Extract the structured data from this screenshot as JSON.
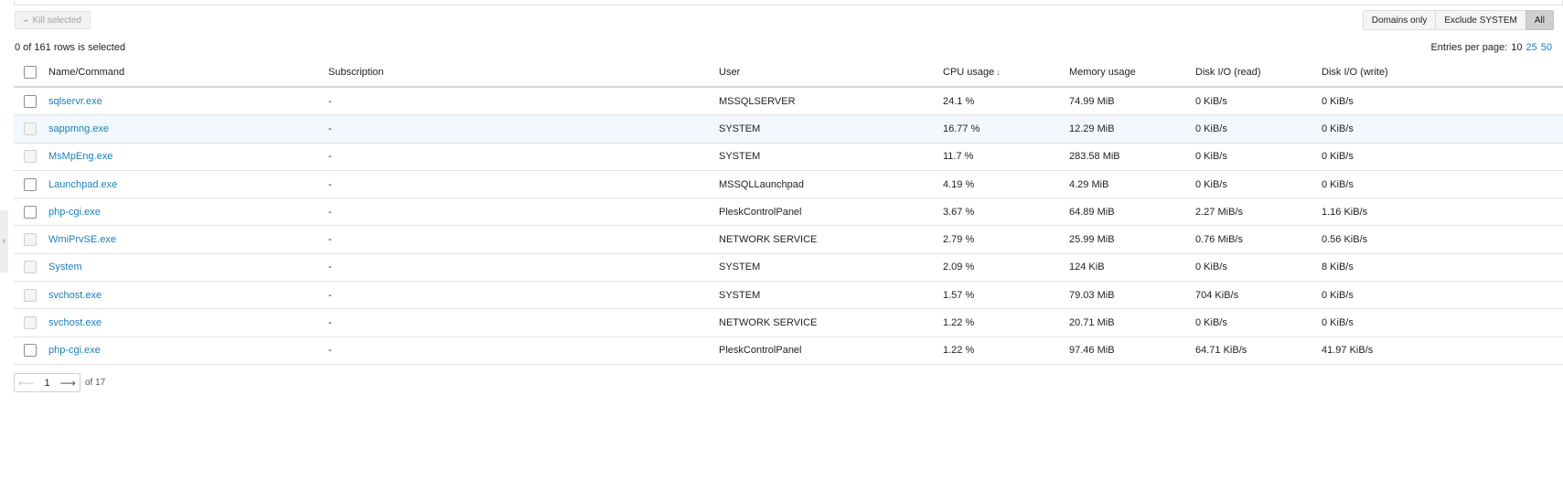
{
  "toolbar": {
    "kill_label": "Kill selected",
    "filters": [
      {
        "label": "Domains only",
        "active": false
      },
      {
        "label": "Exclude SYSTEM",
        "active": false
      },
      {
        "label": "All",
        "active": true
      }
    ]
  },
  "selection": {
    "text": "0 of 161 rows is selected"
  },
  "entries_per_page": {
    "label": "Entries per page:",
    "current": "10",
    "options": [
      "25",
      "50"
    ]
  },
  "table": {
    "columns": [
      "Name/Command",
      "Subscription",
      "User",
      "CPU usage",
      "Memory usage",
      "Disk I/O (read)",
      "Disk I/O (write)"
    ],
    "sort_indicator": "↓",
    "rows": [
      {
        "name": "sqlservr.exe",
        "subscription": "-",
        "user": "MSSQLSERVER",
        "cpu": "24.1 %",
        "memory": "74.99 MiB",
        "disk_read": "0 KiB/s",
        "disk_write": "0 KiB/s",
        "selectable": true
      },
      {
        "name": "sappmng.exe",
        "subscription": "-",
        "user": "SYSTEM",
        "cpu": "16.77 %",
        "memory": "12.29 MiB",
        "disk_read": "0 KiB/s",
        "disk_write": "0 KiB/s",
        "selectable": false
      },
      {
        "name": "MsMpEng.exe",
        "subscription": "-",
        "user": "SYSTEM",
        "cpu": "11.7 %",
        "memory": "283.58 MiB",
        "disk_read": "0 KiB/s",
        "disk_write": "0 KiB/s",
        "selectable": false
      },
      {
        "name": "Launchpad.exe",
        "subscription": "-",
        "user": "MSSQLLaunchpad",
        "cpu": "4.19 %",
        "memory": "4.29 MiB",
        "disk_read": "0 KiB/s",
        "disk_write": "0 KiB/s",
        "selectable": true
      },
      {
        "name": "php-cgi.exe",
        "subscription": "-",
        "user": "PleskControlPanel",
        "cpu": "3.67 %",
        "memory": "64.89 MiB",
        "disk_read": "2.27 MiB/s",
        "disk_write": "1.16 KiB/s",
        "selectable": true
      },
      {
        "name": "WmiPrvSE.exe",
        "subscription": "-",
        "user": "NETWORK SERVICE",
        "cpu": "2.79 %",
        "memory": "25.99 MiB",
        "disk_read": "0.76 MiB/s",
        "disk_write": "0.56 KiB/s",
        "selectable": false
      },
      {
        "name": "System",
        "subscription": "-",
        "user": "SYSTEM",
        "cpu": "2.09 %",
        "memory": "124 KiB",
        "disk_read": "0 KiB/s",
        "disk_write": "8 KiB/s",
        "selectable": false
      },
      {
        "name": "svchost.exe",
        "subscription": "-",
        "user": "SYSTEM",
        "cpu": "1.57 %",
        "memory": "79.03 MiB",
        "disk_read": "704 KiB/s",
        "disk_write": "0 KiB/s",
        "selectable": false
      },
      {
        "name": "svchost.exe",
        "subscription": "-",
        "user": "NETWORK SERVICE",
        "cpu": "1.22 %",
        "memory": "20.71 MiB",
        "disk_read": "0 KiB/s",
        "disk_write": "0 KiB/s",
        "selectable": false
      },
      {
        "name": "php-cgi.exe",
        "subscription": "-",
        "user": "PleskControlPanel",
        "cpu": "1.22 %",
        "memory": "97.46 MiB",
        "disk_read": "64.71 KiB/s",
        "disk_write": "41.97 KiB/s",
        "selectable": true
      }
    ]
  },
  "pagination": {
    "page": "1",
    "of_label": "of 17"
  },
  "icons": {
    "kill": "kill-icon",
    "prev": "arrow-left-icon",
    "next": "arrow-right-icon",
    "side": "chevron-left-icon"
  },
  "colors": {
    "link": "#1a7fb8",
    "highlight_row": "#f2f8fd",
    "active_filter": "#cfcfcf"
  }
}
